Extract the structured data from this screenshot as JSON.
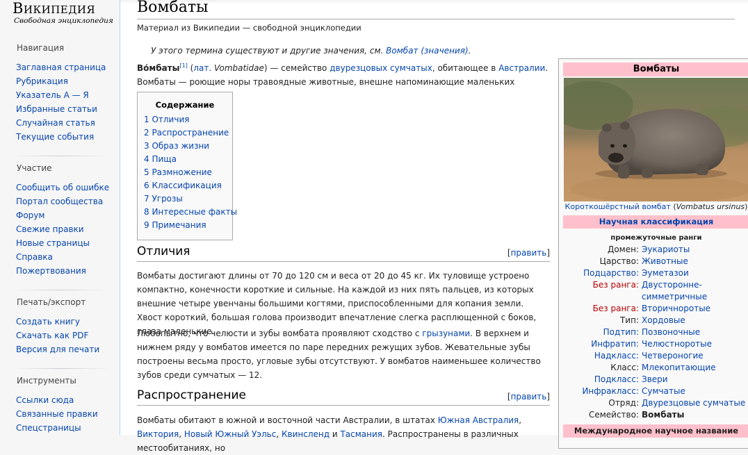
{
  "logo": {
    "title": "Википедия",
    "tagline": "Свободная энциклопедия"
  },
  "sidebar": {
    "navigation": {
      "heading": "Навигация",
      "items": [
        "Заглавная страница",
        "Рубрикация",
        "Указатель А — Я",
        "Избранные статьи",
        "Случайная статья",
        "Текущие события"
      ]
    },
    "participation": {
      "heading": "Участие",
      "items": [
        "Сообщить об ошибке",
        "Портал сообщества",
        "Форум",
        "Свежие правки",
        "Новые страницы",
        "Справка",
        "Пожертвования"
      ]
    },
    "print": {
      "heading": "Печать/экспорт",
      "items": [
        "Создать книгу",
        "Скачать как PDF",
        "Версия для печати"
      ]
    },
    "tools": {
      "heading": "Инструменты",
      "items": [
        "Ссылки сюда",
        "Связанные правки",
        "Спецстраницы"
      ]
    }
  },
  "article": {
    "title": "Вомбаты",
    "site_sub": "Материал из Википедии — свободной энциклопедии",
    "hatnote": {
      "text": "У этого термина существуют и другие значения, см. ",
      "link": "Вомбат (значения)",
      "end": "."
    },
    "lead": {
      "bold": "Во́мбаты",
      "ref": "[1]",
      "open": " (",
      "lat_link": "лат.",
      "lat_name": " Vombatidae",
      "mid": ") — семейство ",
      "family_link": "двурезцовых сумчатых",
      "mid2": ", обитающее в ",
      "australia_link": "Австралии",
      "end": ". Вомбаты — роющие норы травоядные животные, внешне напоминающие маленьких медведей."
    }
  },
  "toc": {
    "title": "Содержание",
    "items": [
      "1 Отличия",
      "2 Распространение",
      "3 Образ жизни",
      "4 Пища",
      "5 Размножение",
      "6 Классификация",
      "7 Угрозы",
      "8 Интересные факты",
      "9 Примечания"
    ]
  },
  "sections": {
    "edit_open": "[",
    "edit_label": "править",
    "edit_close": "]",
    "differences": {
      "title": "Отличия",
      "p1": "Вомбаты достигают длины от 70 до 120 см и веса от 20 до 45 кг. Их туловище устроено компактно, конечности короткие и сильные. На каждой из них пять пальцев, из которых внешние четыре увенчаны большими когтями, приспособленными для копания земли. Хвост короткий, большая голова производит впечатление слегка расплющенной с боков, глаза маленькие.",
      "p2_start": "Любопытно, что челюсти и зубы вомбата проявляют сходство с ",
      "p2_link": "грызунами",
      "p2_end": ". В верхнем и нижнем ряду у вомбатов имеется по паре передних режущих зубов. Жевательные зубы построены весьма просто, угловые зубы отсутствуют. У вомбатов наименьшее количество зубов среди сумчатых — 12."
    },
    "distribution": {
      "title": "Распространение",
      "p_start": "Вомбаты обитают в южной и восточной части Австралии, в штатах ",
      "link1": "Южная Австралия",
      "comma1": ", ",
      "link2": "Виктория",
      "comma2": ", ",
      "link3": "Новый Южный Уэльс",
      "comma3": ", ",
      "link4": "Квинсленд",
      "and": " и ",
      "link5": "Тасмания",
      "p_end": ". Распространены в различных местообитаниях, но"
    }
  },
  "infobox": {
    "title": "Вомбаты",
    "caption_link": "Короткошёрстный вомбат",
    "caption_open": " (",
    "caption_latin": "Vombatus ursinus",
    "caption_close": ")",
    "classification": "Научная классификация",
    "intermediate_ranks": "промежуточные ранги",
    "rows": [
      {
        "label": "Домен:",
        "value": "Эукариоты"
      },
      {
        "label": "Царство:",
        "value": "Животные"
      },
      {
        "label": "Подцарство:",
        "value": "Эуметазои"
      },
      {
        "label": "Без ранга:",
        "value": "Двусторонне-симметричные"
      },
      {
        "label": "Без ранга:",
        "value": "Вторичноротые"
      },
      {
        "label": "Тип:",
        "value": "Хордовые"
      },
      {
        "label": "Подтип:",
        "value": "Позвоночные"
      },
      {
        "label": "Инфратип:",
        "value": "Челюстноротые"
      },
      {
        "label": "Надкласс:",
        "value": "Четвероногие"
      },
      {
        "label": "Класс:",
        "value": "Млекопитающие"
      },
      {
        "label": "Подкласс:",
        "value": "Звери"
      },
      {
        "label": "Инфракласс:",
        "value": "Сумчатые"
      },
      {
        "label": "Отряд:",
        "value": "Двурезцовые сумчатые"
      },
      {
        "label": "Семейство:",
        "value": "Вомбаты"
      }
    ],
    "intl_name": "Международное научное название"
  },
  "colors": {
    "link": "#0645ad",
    "redlink": "#ba0000",
    "infobox_header": "#ffc0cb",
    "sidebar_bg": "#f6f6f6"
  }
}
